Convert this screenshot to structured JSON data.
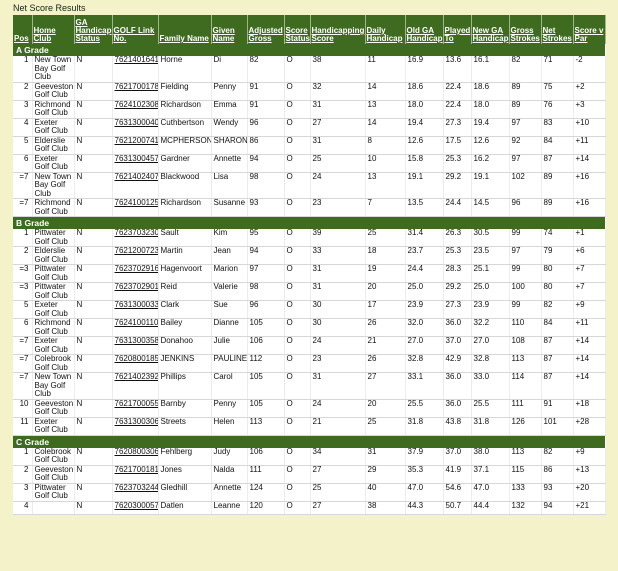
{
  "page": {
    "title": "Net Score Results"
  },
  "headers": {
    "pos": "Pos",
    "club": "Home Club",
    "ga_status": "GA Handicap Status",
    "golf_link": "GOLF Link No.",
    "family": "Family Name",
    "given": "Given Name",
    "adj_gross": "Adjusted Gross",
    "score_status": "Score Status",
    "hcp_score": "Handicapping Score",
    "daily_hcp": "Daily Handicap",
    "old_ga": "Old GA Handicap",
    "played_to": "Played To",
    "new_ga": "New GA Handicap",
    "gross": "Gross Strokes",
    "net": "Net Strokes",
    "vs_par": "Score v Par"
  },
  "grades": [
    {
      "name": "A Grade",
      "rows": [
        {
          "pos": "1",
          "club": "New Town Bay Golf Club",
          "ga": "N",
          "link": "7621401641",
          "family": "Horne",
          "given": "Di",
          "adj": "82",
          "status": "O",
          "hcp_score": "38",
          "daily": "11",
          "old": "16.9",
          "played": "13.6",
          "new": "16.1",
          "gross": "82",
          "net": "71",
          "par": "-2"
        },
        {
          "pos": "2",
          "club": "Geeveston Golf Club",
          "ga": "N",
          "link": "7621700178",
          "family": "Fielding",
          "given": "Penny",
          "adj": "91",
          "status": "O",
          "hcp_score": "32",
          "daily": "14",
          "old": "18.6",
          "played": "22.4",
          "new": "18.6",
          "gross": "89",
          "net": "75",
          "par": "+2"
        },
        {
          "pos": "3",
          "club": "Richmond Golf Club",
          "ga": "N",
          "link": "7624102308",
          "family": "Richardson",
          "given": "Emma",
          "adj": "91",
          "status": "O",
          "hcp_score": "31",
          "daily": "13",
          "old": "18.0",
          "played": "22.4",
          "new": "18.0",
          "gross": "89",
          "net": "76",
          "par": "+3"
        },
        {
          "pos": "4",
          "club": "Exeter Golf Club",
          "ga": "N",
          "link": "7631300040",
          "family": "Cuthbertson",
          "given": "Wendy",
          "adj": "96",
          "status": "O",
          "hcp_score": "27",
          "daily": "14",
          "old": "19.4",
          "played": "27.3",
          "new": "19.4",
          "gross": "97",
          "net": "83",
          "par": "+10"
        },
        {
          "pos": "5",
          "club": "Elderslie Golf Club",
          "ga": "N",
          "link": "7621200741",
          "family": "MCPHERSON",
          "given": "SHARON",
          "adj": "86",
          "status": "O",
          "hcp_score": "31",
          "daily": "8",
          "old": "12.6",
          "played": "17.5",
          "new": "12.6",
          "gross": "92",
          "net": "84",
          "par": "+11"
        },
        {
          "pos": "6",
          "club": "Exeter Golf Club",
          "ga": "N",
          "link": "7631300457",
          "family": "Gardner",
          "given": "Annette",
          "adj": "94",
          "status": "O",
          "hcp_score": "25",
          "daily": "10",
          "old": "15.8",
          "played": "25.3",
          "new": "16.2",
          "gross": "97",
          "net": "87",
          "par": "+14"
        },
        {
          "pos": "=7",
          "club": "New Town Bay Golf Club",
          "ga": "N",
          "link": "7621402407",
          "family": "Blackwood",
          "given": "Lisa",
          "adj": "98",
          "status": "O",
          "hcp_score": "24",
          "daily": "13",
          "old": "19.1",
          "played": "29.2",
          "new": "19.1",
          "gross": "102",
          "net": "89",
          "par": "+16"
        },
        {
          "pos": "=7",
          "club": "Richmond Golf Club",
          "ga": "N",
          "link": "7624100125",
          "family": "Richardson",
          "given": "Susanne",
          "adj": "93",
          "status": "O",
          "hcp_score": "23",
          "daily": "7",
          "old": "13.5",
          "played": "24.4",
          "new": "14.5",
          "gross": "96",
          "net": "89",
          "par": "+16"
        }
      ]
    },
    {
      "name": "B Grade",
      "rows": [
        {
          "pos": "1",
          "club": "Pittwater Golf Club",
          "ga": "N",
          "link": "7623703230",
          "family": "Sault",
          "given": "Kim",
          "adj": "95",
          "status": "O",
          "hcp_score": "39",
          "daily": "25",
          "old": "31.4",
          "played": "26.3",
          "new": "30.5",
          "gross": "99",
          "net": "74",
          "par": "+1"
        },
        {
          "pos": "2",
          "club": "Elderslie Golf Club",
          "ga": "N",
          "link": "7621200723",
          "family": "Martin",
          "given": "Jean",
          "adj": "94",
          "status": "O",
          "hcp_score": "33",
          "daily": "18",
          "old": "23.7",
          "played": "25.3",
          "new": "23.5",
          "gross": "97",
          "net": "79",
          "par": "+6"
        },
        {
          "pos": "=3",
          "club": "Pittwater Golf Club",
          "ga": "N",
          "link": "7623702916",
          "family": "Hagenvoort",
          "given": "Marion",
          "adj": "97",
          "status": "O",
          "hcp_score": "31",
          "daily": "19",
          "old": "24.4",
          "played": "28.3",
          "new": "25.1",
          "gross": "99",
          "net": "80",
          "par": "+7"
        },
        {
          "pos": "=3",
          "club": "Pittwater Golf Club",
          "ga": "N",
          "link": "7623702901",
          "family": "Reid",
          "given": "Valerie",
          "adj": "98",
          "status": "O",
          "hcp_score": "31",
          "daily": "20",
          "old": "25.0",
          "played": "29.2",
          "new": "25.0",
          "gross": "100",
          "net": "80",
          "par": "+7"
        },
        {
          "pos": "5",
          "club": "Exeter Golf Club",
          "ga": "N",
          "link": "7631300033",
          "family": "Clark",
          "given": "Sue",
          "adj": "96",
          "status": "O",
          "hcp_score": "30",
          "daily": "17",
          "old": "23.9",
          "played": "27.3",
          "new": "23.9",
          "gross": "99",
          "net": "82",
          "par": "+9"
        },
        {
          "pos": "6",
          "club": "Richmond Golf Club",
          "ga": "N",
          "link": "7624100110",
          "family": "Bailey",
          "given": "Dianne",
          "adj": "105",
          "status": "O",
          "hcp_score": "30",
          "daily": "26",
          "old": "32.0",
          "played": "36.0",
          "new": "32.2",
          "gross": "110",
          "net": "84",
          "par": "+11"
        },
        {
          "pos": "=7",
          "club": "Exeter Golf Club",
          "ga": "N",
          "link": "7631300358",
          "family": "Donahoo",
          "given": "Julie",
          "adj": "106",
          "status": "O",
          "hcp_score": "24",
          "daily": "21",
          "old": "27.0",
          "played": "37.0",
          "new": "27.0",
          "gross": "108",
          "net": "87",
          "par": "+14"
        },
        {
          "pos": "=7",
          "club": "Colebrook Golf Club",
          "ga": "N",
          "link": "7620800185",
          "family": "JENKINS",
          "given": "PAULINE",
          "adj": "112",
          "status": "O",
          "hcp_score": "23",
          "daily": "26",
          "old": "32.8",
          "played": "42.9",
          "new": "32.8",
          "gross": "113",
          "net": "87",
          "par": "+14"
        },
        {
          "pos": "=7",
          "club": "New Town Bay Golf Club",
          "ga": "N",
          "link": "7621402392",
          "family": "Phillips",
          "given": "Carol",
          "adj": "105",
          "status": "O",
          "hcp_score": "31",
          "daily": "27",
          "old": "33.1",
          "played": "36.0",
          "new": "33.0",
          "gross": "114",
          "net": "87",
          "par": "+14"
        },
        {
          "pos": "10",
          "club": "Geeveston Golf Club",
          "ga": "N",
          "link": "7621700055",
          "family": "Barnby",
          "given": "Penny",
          "adj": "105",
          "status": "O",
          "hcp_score": "24",
          "daily": "20",
          "old": "25.5",
          "played": "36.0",
          "new": "25.5",
          "gross": "111",
          "net": "91",
          "par": "+18"
        },
        {
          "pos": "11",
          "club": "Exeter Golf Club",
          "ga": "N",
          "link": "7631300306",
          "family": "Streets",
          "given": "Helen",
          "adj": "113",
          "status": "O",
          "hcp_score": "21",
          "daily": "25",
          "old": "31.8",
          "played": "43.8",
          "new": "31.8",
          "gross": "126",
          "net": "101",
          "par": "+28"
        }
      ]
    },
    {
      "name": "C Grade",
      "rows": [
        {
          "pos": "1",
          "club": "Colebrook Golf Club",
          "ga": "N",
          "link": "7620800306",
          "family": "Fehlberg",
          "given": "Judy",
          "adj": "106",
          "status": "O",
          "hcp_score": "34",
          "daily": "31",
          "old": "37.9",
          "played": "37.0",
          "new": "38.0",
          "gross": "113",
          "net": "82",
          "par": "+9"
        },
        {
          "pos": "2",
          "club": "Geeveston Golf Club",
          "ga": "N",
          "link": "7621700181",
          "family": "Jones",
          "given": "Nalda",
          "adj": "111",
          "status": "O",
          "hcp_score": "27",
          "daily": "29",
          "old": "35.3",
          "played": "41.9",
          "new": "37.1",
          "gross": "115",
          "net": "86",
          "par": "+13"
        },
        {
          "pos": "3",
          "club": "Pittwater Golf Club",
          "ga": "N",
          "link": "7623703244",
          "family": "Gledhill",
          "given": "Annette",
          "adj": "124",
          "status": "O",
          "hcp_score": "25",
          "daily": "40",
          "old": "47.0",
          "played": "54.6",
          "new": "47.0",
          "gross": "133",
          "net": "93",
          "par": "+20"
        },
        {
          "pos": "4",
          "club": "",
          "ga": "N",
          "link": "7620300057",
          "family": "Datlen",
          "given": "Leanne",
          "adj": "120",
          "status": "O",
          "hcp_score": "27",
          "daily": "38",
          "old": "44.3",
          "played": "50.7",
          "new": "44.4",
          "gross": "132",
          "net": "94",
          "par": "+21"
        }
      ]
    }
  ]
}
